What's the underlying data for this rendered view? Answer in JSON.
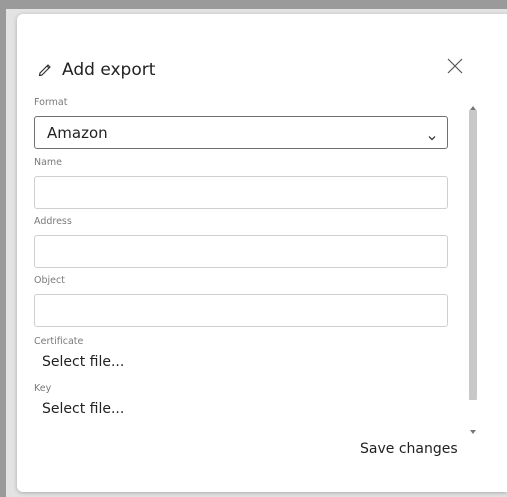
{
  "dialog": {
    "title": "Add export",
    "title_icon": "pencil-icon",
    "close_icon": "close-icon"
  },
  "form": {
    "format_label": "Format",
    "format_value": "Amazon",
    "name_label": "Name",
    "name_value": "",
    "address_label": "Address",
    "address_value": "",
    "object_label": "Object",
    "object_value": "",
    "certificate_label": "Certificate",
    "certificate_file": "Select file...",
    "key_label": "Key",
    "key_file": "Select file..."
  },
  "footer": {
    "save_label": "Save changes"
  },
  "colors": {
    "backdrop": "#9a9a9a",
    "modal_bg": "#ffffff",
    "border": "#cfcfcf",
    "label": "#7a7a7a"
  }
}
